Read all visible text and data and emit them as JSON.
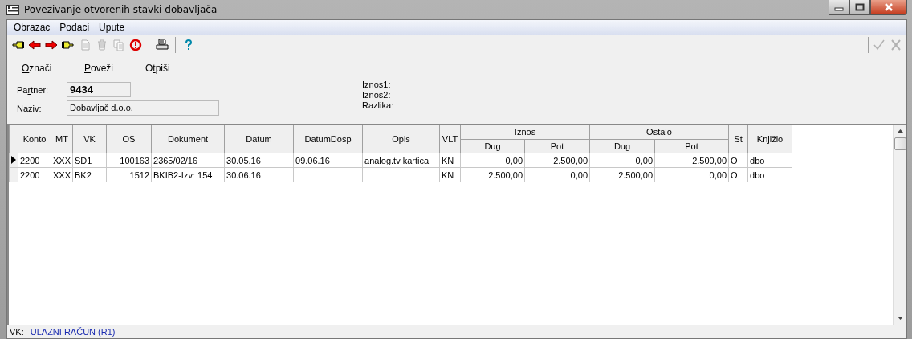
{
  "window": {
    "title": "Povezivanje otvorenih stavki dobavljača"
  },
  "menu": [
    "Obrazac",
    "Podaci",
    "Upute"
  ],
  "toolbar": [
    {
      "disabled": false
    },
    {
      "disabled": false
    },
    {
      "disabled": false
    },
    {
      "disabled": false
    },
    {
      "disabled": true
    },
    {
      "disabled": true
    },
    {
      "disabled": true
    },
    {
      "disabled": false
    },
    {
      "disabled": false
    },
    {
      "disabled": false
    }
  ],
  "toolbar_right": [
    {
      "disabled": true
    },
    {
      "disabled": true
    }
  ],
  "actions": [
    {
      "key": "O",
      "rest": "znači"
    },
    {
      "key": "P",
      "rest": "oveži"
    },
    {
      "lead": "O",
      "key": "t",
      "rest": "piši"
    }
  ],
  "form": {
    "partner_label": {
      "lead": "Pa",
      "key": "r",
      "rest": "tner:"
    },
    "partner": "9434",
    "naziv_label": "Naziv:",
    "naziv": "Dobavljač d.o.o.",
    "totals": [
      "Iznos1:",
      "Iznos2:",
      "Razlika:"
    ]
  },
  "table": {
    "columns": [
      "Konto",
      "MT",
      "VK",
      "OS",
      "Dokument",
      "Datum",
      "DatumDosp",
      "Opis",
      "VLT"
    ],
    "groups": [
      {
        "label": "Iznos",
        "columns": [
          "Dug",
          "Pot"
        ]
      },
      {
        "label": "Ostalo",
        "columns": [
          "Dug",
          "Pot"
        ]
      }
    ],
    "columns_after": [
      "St",
      "Knjižio"
    ],
    "rows": [
      {
        "selected": true,
        "cells": [
          "2200",
          "XXX",
          "SD1",
          "100163",
          "2365/02/16",
          "30.05.16",
          "09.06.16",
          "analog.tv kartica",
          "KN",
          "0,00",
          "2.500,00",
          "0,00",
          "2.500,00",
          "O",
          "dbo"
        ]
      },
      {
        "selected": false,
        "cells": [
          "2200",
          "XXX",
          "BK2",
          "1512",
          "BKIB2-Izv: 154",
          "30.06.16",
          "",
          "",
          "KN",
          "2.500,00",
          "0,00",
          "2.500,00",
          "0,00",
          "O",
          "dbo"
        ]
      }
    ]
  },
  "status_bar": {
    "label": "VK:",
    "value": "ULAZNI RAČUN (R1)"
  }
}
